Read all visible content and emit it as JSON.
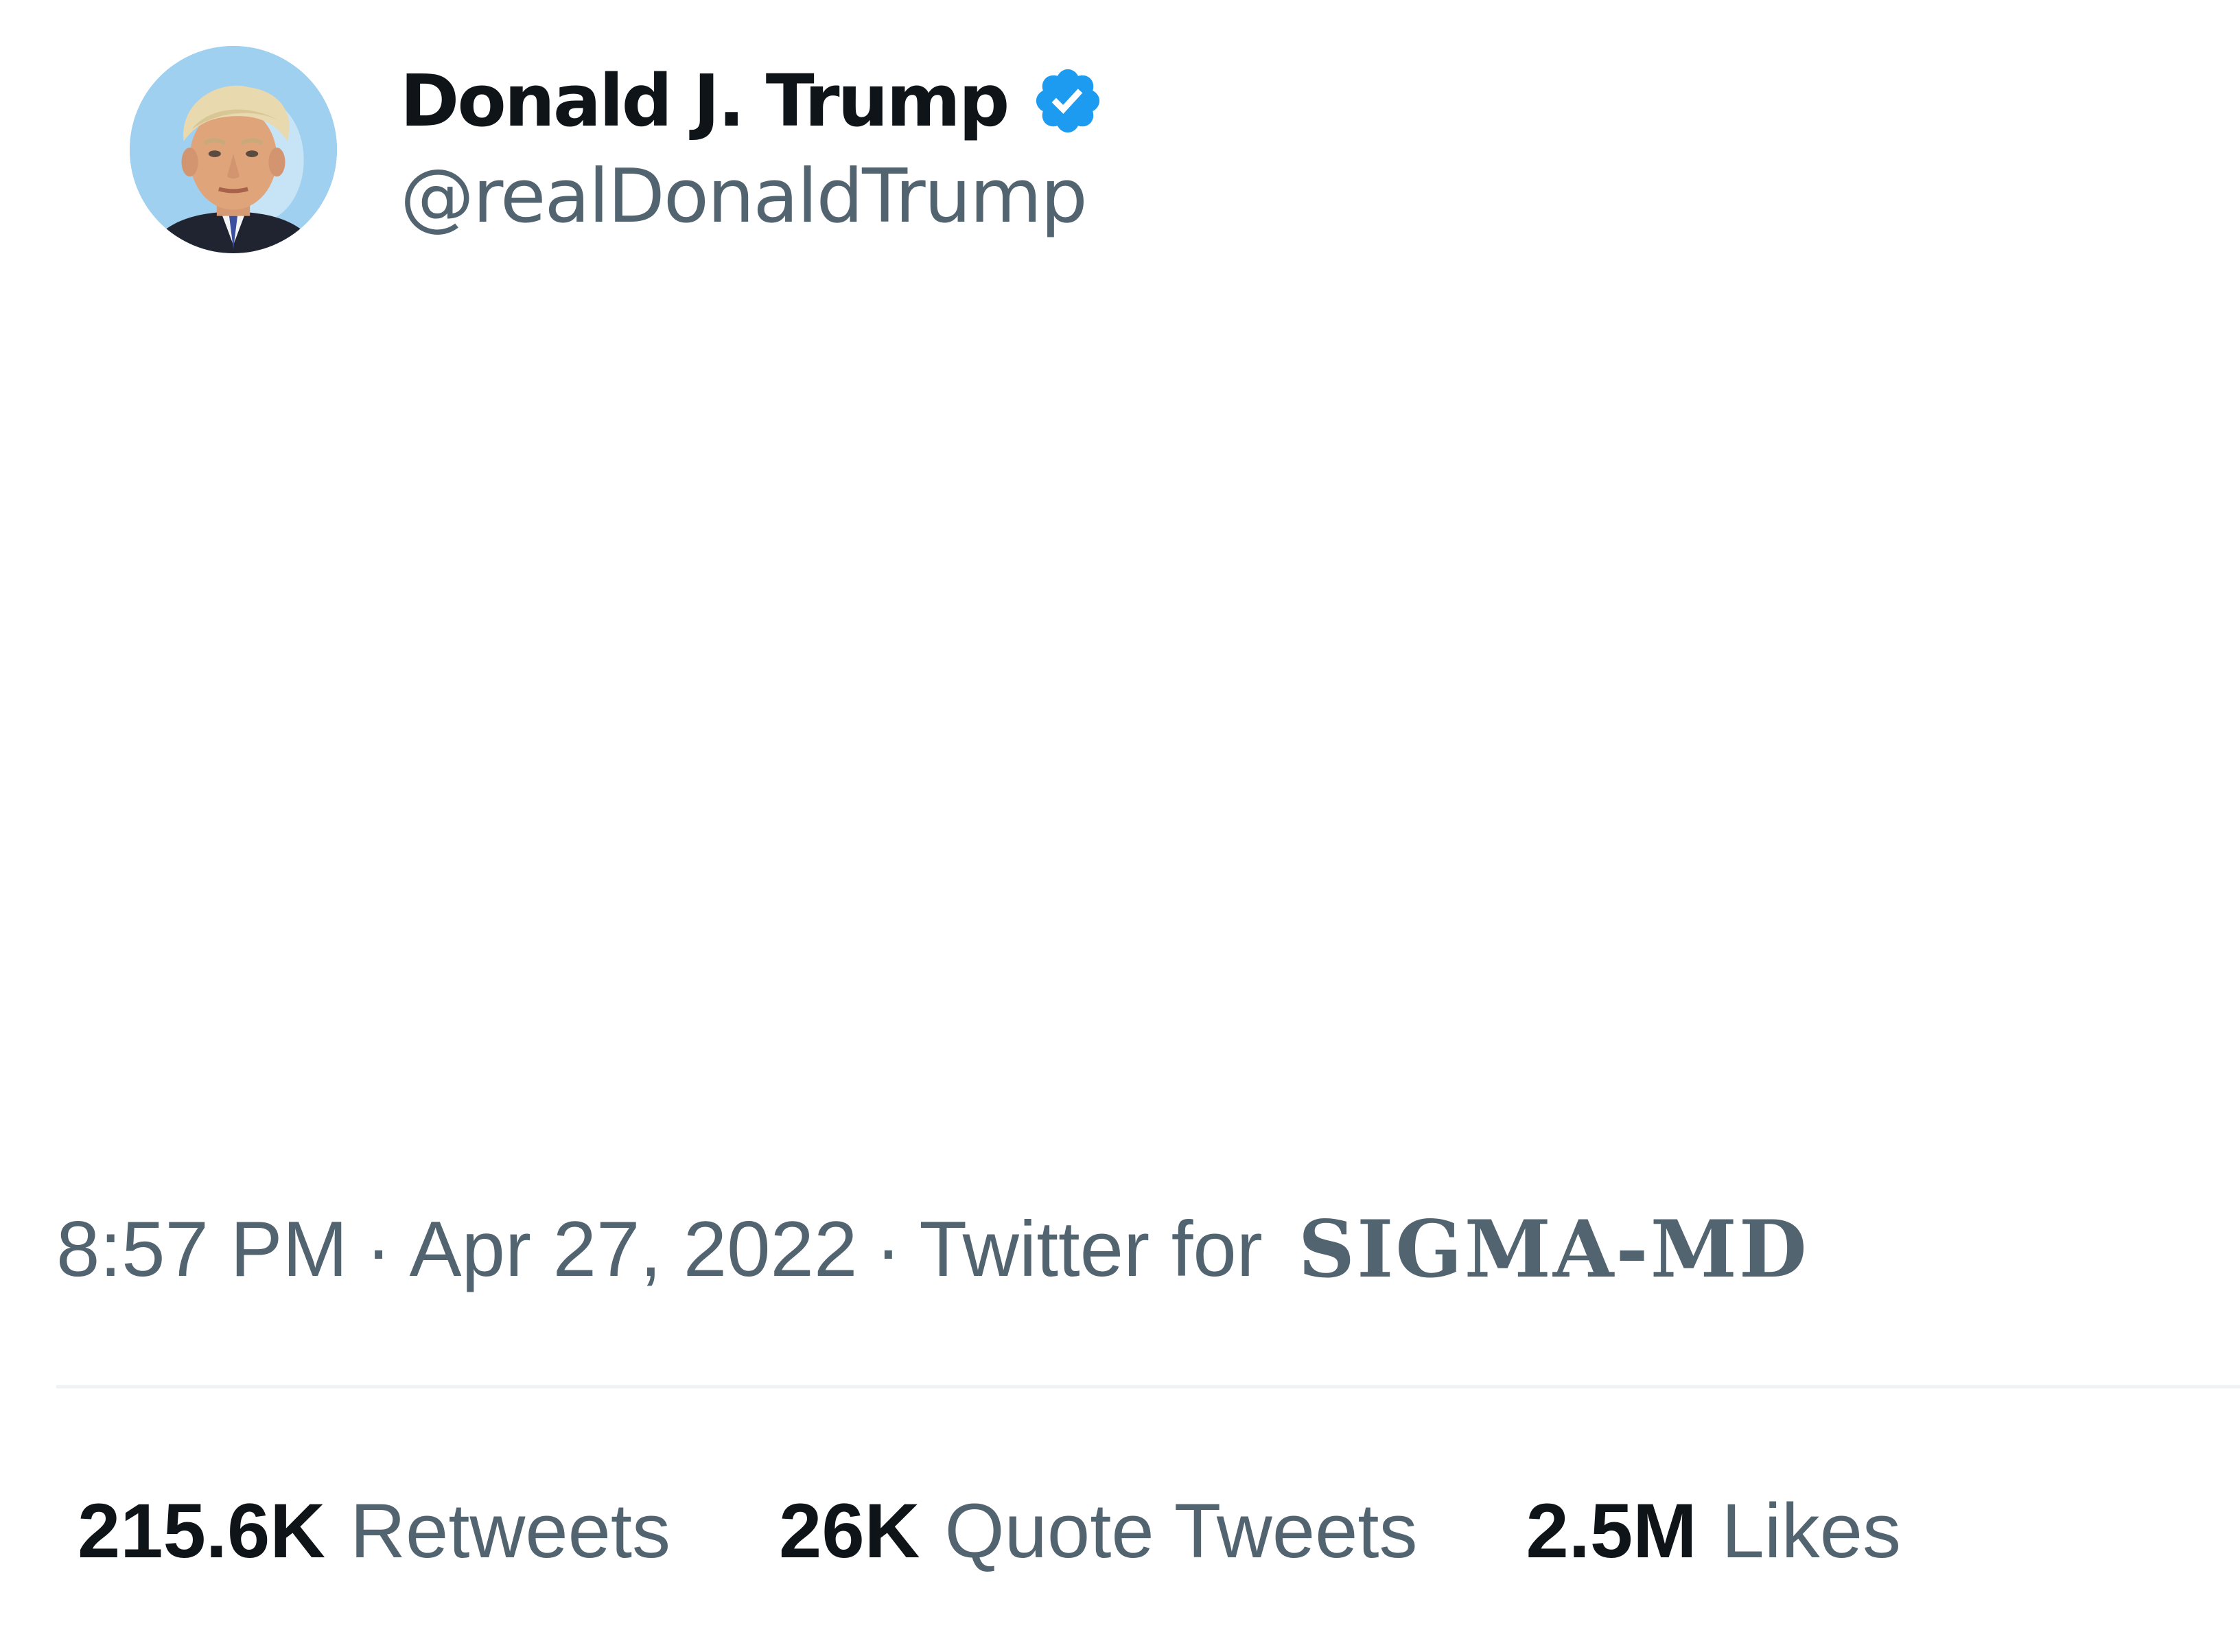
{
  "author": {
    "display_name": "Donald J. Trump",
    "handle": "@realDonaldTrump",
    "verified": true,
    "avatar_icon": "profile-photo",
    "verified_icon": "verified-badge-icon",
    "verified_color": "#1d9bf0"
  },
  "meta": {
    "time": "8:57 PM",
    "separator": "·",
    "date": "Apr 27, 2022",
    "source_prefix": "Twitter for",
    "client": "SIGMA-MD"
  },
  "stats": {
    "retweets": {
      "value": "215.6K",
      "label": "Retweets"
    },
    "quote_tweets": {
      "value": "26K",
      "label": "Quote Tweets"
    },
    "likes": {
      "value": "2.5M",
      "label": "Likes"
    }
  },
  "colors": {
    "text_primary": "#0f1419",
    "text_secondary": "#536471",
    "divider": "#eff3f4",
    "background": "#ffffff"
  }
}
